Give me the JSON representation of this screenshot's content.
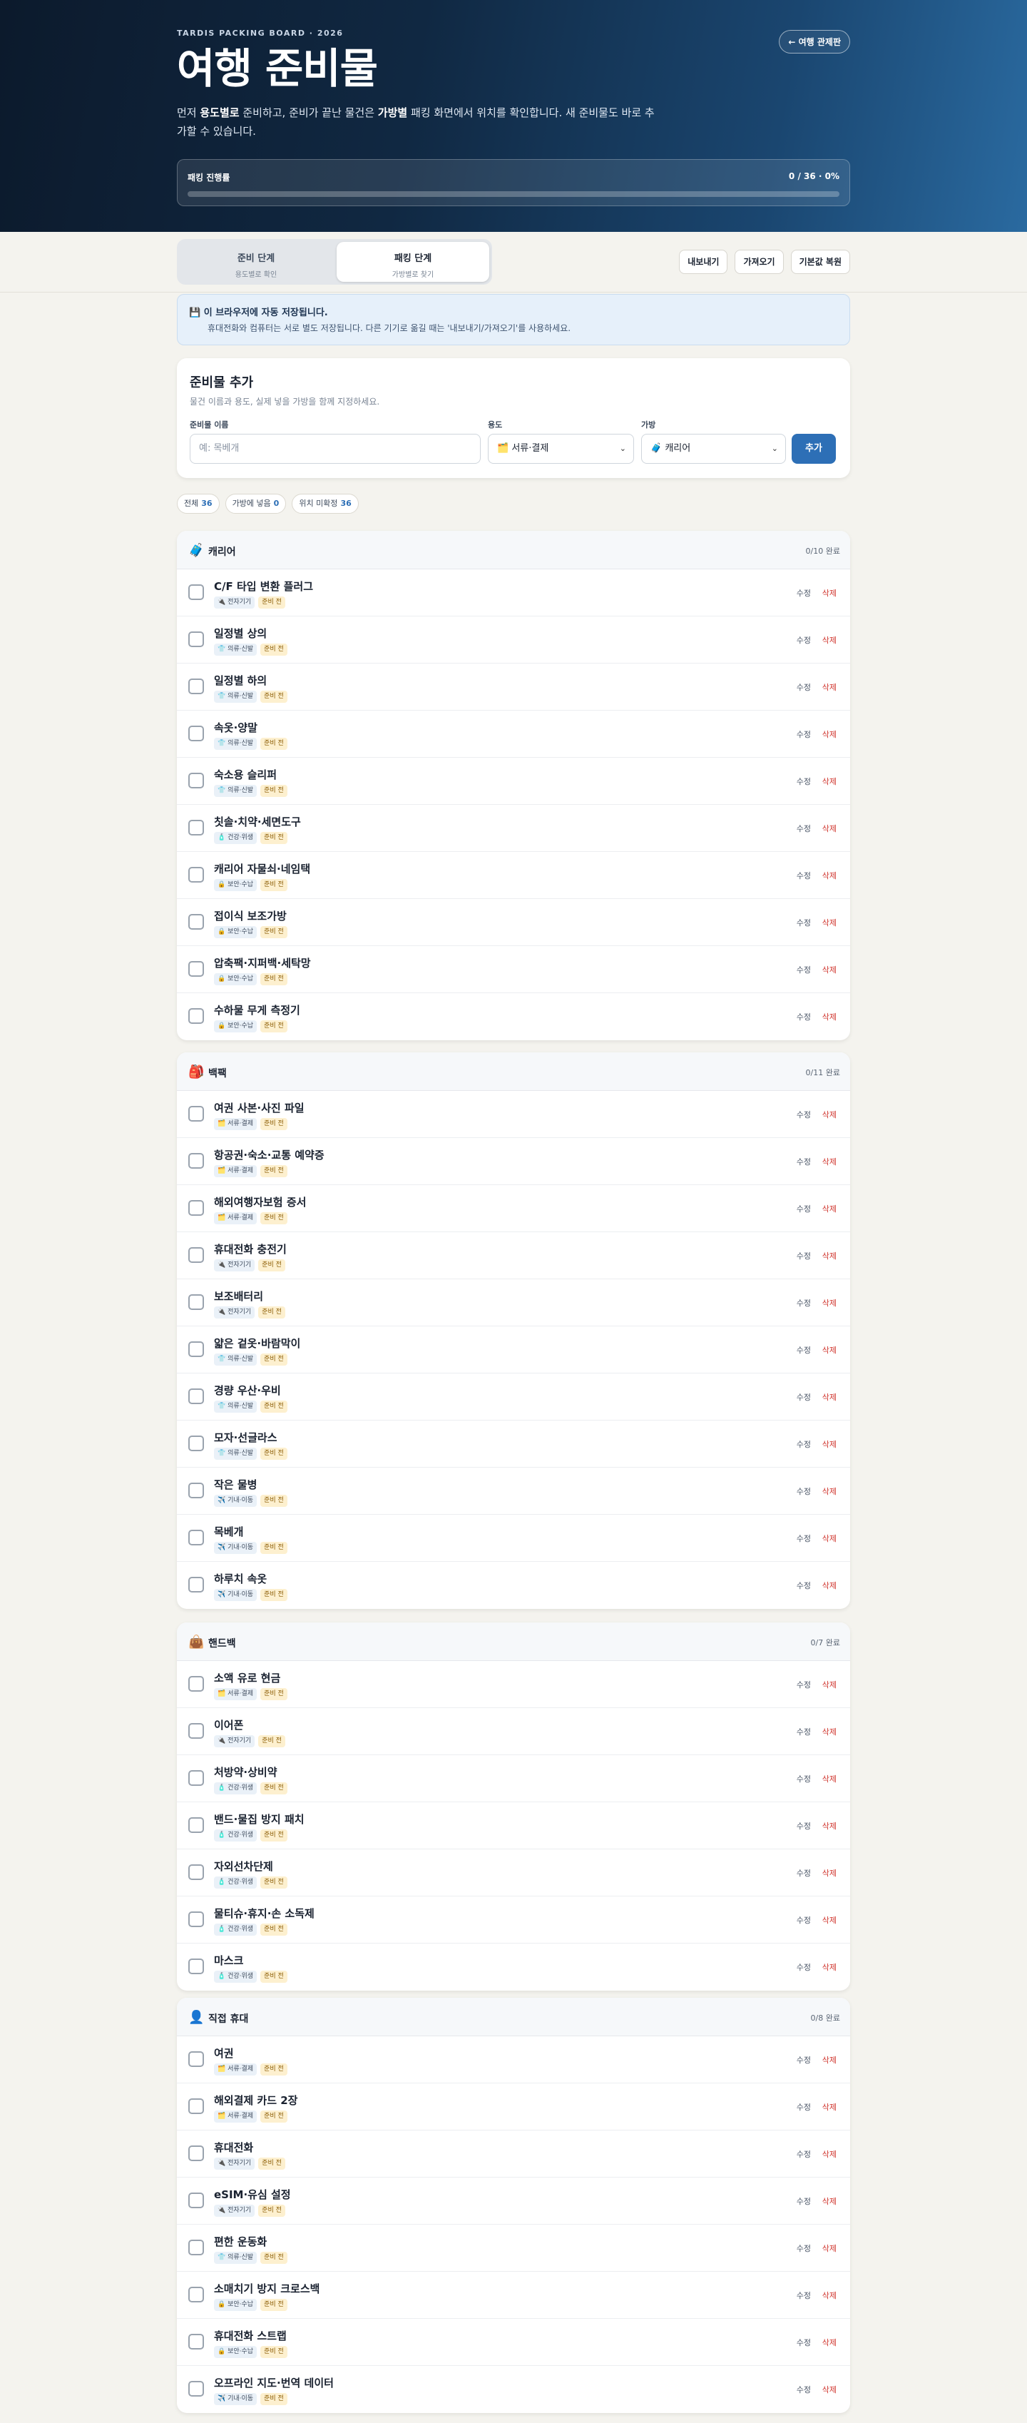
{
  "hero": {
    "eyebrow": "TARDIS PACKING BOARD · 2026",
    "title": "여행 준비물",
    "desc_pre": "먼저 ",
    "desc_b1": "용도별로",
    "desc_mid": " 준비하고, 준비가 끝난 물건은 ",
    "desc_b2": "가방별",
    "desc_post": " 패킹 화면에서 위치를 확인합니다. 새 준비물도 바로 추가할 수 있습니다.",
    "back_label": "← 여행 관제판",
    "progress_label": "패킹 진행률",
    "progress_text": "0 / 36 · 0%",
    "progress_value": 0
  },
  "toolbar": {
    "tabs": [
      {
        "label": "준비 단계",
        "sub": "용도별로 확인"
      },
      {
        "label": "패킹 단계",
        "sub": "가방별로 찾기"
      }
    ],
    "export_label": "내보내기",
    "import_label": "가져오기",
    "reset_label": "기본값 복원"
  },
  "notice": {
    "icon": "save-icon",
    "title": "이 브라우저에 자동 저장됩니다.",
    "text": "휴대전화와 컴퓨터는 서로 별도 저장됩니다. 다른 기기로 옮길 때는 '내보내기/가져오기'를 사용하세요."
  },
  "add_form": {
    "title": "준비물 추가",
    "subtitle": "물건 이름과 용도, 실제 넣을 가방을 함께 지정하세요.",
    "name_label": "준비물 이름",
    "name_placeholder": "예: 목베개",
    "purpose_label": "용도",
    "purpose_value": "🗂️ 서류·결제",
    "bag_label": "가방",
    "bag_value": "🧳 캐리어",
    "add_label": "추가"
  },
  "filters": [
    {
      "label": "전체",
      "count": "36"
    },
    {
      "label": "가방에 넣음",
      "count": "0"
    },
    {
      "label": "위치 미확정",
      "count": "36"
    }
  ],
  "labels": {
    "edit": "수정",
    "delete": "삭제",
    "status": "준비 전"
  },
  "groups": [
    {
      "icon": "🧳",
      "title": "캐리어",
      "count": "0/10 완료",
      "items": [
        {
          "name": "C/F 타입 변환 플러그",
          "tag": "🔌 전자기기"
        },
        {
          "name": "일정별 상의",
          "tag": "👕 의류·신발"
        },
        {
          "name": "일정별 하의",
          "tag": "👕 의류·신발"
        },
        {
          "name": "속옷·양말",
          "tag": "👕 의류·신발"
        },
        {
          "name": "숙소용 슬리퍼",
          "tag": "👕 의류·신발"
        },
        {
          "name": "칫솔·치약·세면도구",
          "tag": "🧴 건강·위생"
        },
        {
          "name": "캐리어 자물쇠·네임택",
          "tag": "🔒 보안·수납"
        },
        {
          "name": "접이식 보조가방",
          "tag": "🔒 보안·수납"
        },
        {
          "name": "압축팩·지퍼백·세탁망",
          "tag": "🔒 보안·수납"
        },
        {
          "name": "수하물 무게 측정기",
          "tag": "🔒 보안·수납"
        }
      ]
    },
    {
      "icon": "🎒",
      "title": "백팩",
      "count": "0/11 완료",
      "items": [
        {
          "name": "여권 사본·사진 파일",
          "tag": "🗂️ 서류·결제"
        },
        {
          "name": "항공권·숙소·교통 예약증",
          "tag": "🗂️ 서류·결제"
        },
        {
          "name": "해외여행자보험 증서",
          "tag": "🗂️ 서류·결제"
        },
        {
          "name": "휴대전화 충전기",
          "tag": "🔌 전자기기"
        },
        {
          "name": "보조배터리",
          "tag": "🔌 전자기기"
        },
        {
          "name": "얇은 겉옷·바람막이",
          "tag": "👕 의류·신발"
        },
        {
          "name": "경량 우산·우비",
          "tag": "👕 의류·신발"
        },
        {
          "name": "모자·선글라스",
          "tag": "👕 의류·신발"
        },
        {
          "name": "작은 물병",
          "tag": "✈️ 기내·이동"
        },
        {
          "name": "목베개",
          "tag": "✈️ 기내·이동"
        },
        {
          "name": "하루치 속옷",
          "tag": "✈️ 기내·이동"
        }
      ]
    },
    {
      "icon": "👜",
      "title": "핸드백",
      "count": "0/7 완료",
      "items": [
        {
          "name": "소액 유로 현금",
          "tag": "🗂️ 서류·결제"
        },
        {
          "name": "이어폰",
          "tag": "🔌 전자기기"
        },
        {
          "name": "처방약·상비약",
          "tag": "🧴 건강·위생"
        },
        {
          "name": "밴드·물집 방지 패치",
          "tag": "🧴 건강·위생"
        },
        {
          "name": "자외선차단제",
          "tag": "🧴 건강·위생"
        },
        {
          "name": "물티슈·휴지·손 소독제",
          "tag": "🧴 건강·위생"
        },
        {
          "name": "마스크",
          "tag": "🧴 건강·위생"
        }
      ]
    },
    {
      "icon": "👤",
      "title": "직접 휴대",
      "count": "0/8 완료",
      "items": [
        {
          "name": "여권",
          "tag": "🗂️ 서류·결제"
        },
        {
          "name": "해외결제 카드 2장",
          "tag": "🗂️ 서류·결제"
        },
        {
          "name": "휴대전화",
          "tag": "🔌 전자기기"
        },
        {
          "name": "eSIM·유심 설정",
          "tag": "🔌 전자기기"
        },
        {
          "name": "편한 운동화",
          "tag": "👕 의류·신발"
        },
        {
          "name": "소매치기 방지 크로스백",
          "tag": "🔒 보안·수납"
        },
        {
          "name": "휴대전화 스트랩",
          "tag": "🔒 보안·수납"
        },
        {
          "name": "오프라인 지도·번역 데이터",
          "tag": "✈️ 기내·이동"
        }
      ]
    }
  ]
}
